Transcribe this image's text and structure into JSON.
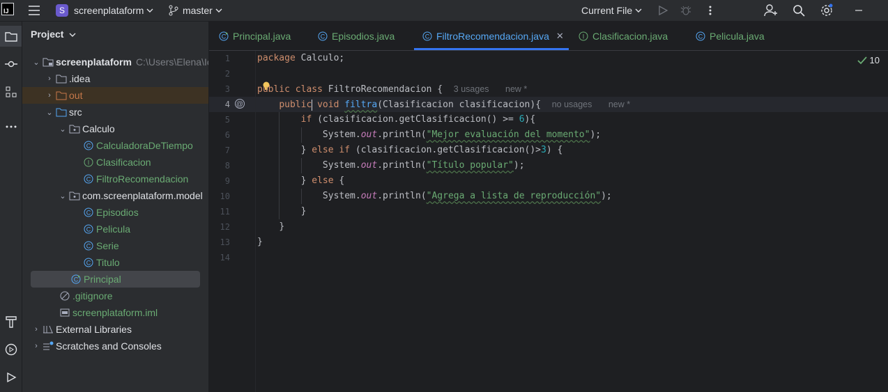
{
  "topbar": {
    "project_initial": "S",
    "project_name": "screenplataform",
    "branch": "master",
    "run_config": "Current File"
  },
  "project_panel": {
    "title": "Project",
    "root": "screenplataform",
    "root_path": "C:\\Users\\Elena\\Ic",
    "items": {
      "idea": ".idea",
      "out": "out",
      "src": "src",
      "calculo": "Calculo",
      "calculadora": "CalculadoraDeTiempo",
      "clasificacion": "Clasificacion",
      "filtro": "FiltroRecomendacion",
      "model": "com.screenplataform.model",
      "episodios": "Episodios",
      "pelicula": "Pelicula",
      "serie": "Serie",
      "titulo": "Titulo",
      "principal": "Principal",
      "gitignore": ".gitignore",
      "iml": "screenplataform.iml",
      "external": "External Libraries",
      "scratches": "Scratches and Consoles"
    }
  },
  "tabs": [
    {
      "label": "Principal.java"
    },
    {
      "label": "Episodios.java"
    },
    {
      "label": "FiltroRecomendacion.java"
    },
    {
      "label": "Clasificacion.java"
    },
    {
      "label": "Pelicula.java"
    }
  ],
  "editor": {
    "inspection_count": "10",
    "line_numbers": [
      "1",
      "2",
      "3",
      "4",
      "5",
      "6",
      "7",
      "8",
      "9",
      "10",
      "11",
      "12",
      "13",
      "14"
    ],
    "code": {
      "l1_kw": "package",
      "l1_rest": " Calculo;",
      "l3_kw1": "public",
      "l3_kw2": "class",
      "l3_name": "FiltroRecomendacion",
      "l3_brace": " {",
      "l3_hint_usages": "3 usages",
      "l3_hint_new": "new *",
      "l4_kw1": "public",
      "l4_kw2": "void",
      "l4_fn": "filtra",
      "l4_params": "(Clasificacion clasificacion){",
      "l4_hint_usages": "no usages",
      "l4_hint_new": "new *",
      "l5_kw": "if",
      "l5_a": " (clasificacion.getClasificacion() >= ",
      "l5_num": "6",
      "l5_b": "){",
      "l6_a": "System.",
      "l6_out": "out",
      "l6_b": ".println(",
      "l6_str": "\"Mejor evaluación del momento\"",
      "l6_c": ");",
      "l7_a": "} ",
      "l7_kw1": "else",
      "l7_kw2": "if",
      "l7_b": " (clasificacion.getClasificacion()>",
      "l7_num": "3",
      "l7_c": ") {",
      "l8_a": "System.",
      "l8_out": "out",
      "l8_b": ".println(",
      "l8_str": "\"Título popular\"",
      "l8_c": ");",
      "l9_a": "} ",
      "l9_kw": "else",
      "l9_b": " {",
      "l10_a": "System.",
      "l10_out": "out",
      "l10_b": ".println(",
      "l10_str": "\"Agrega a lista de reproducción\"",
      "l10_c": ");",
      "l11": "}",
      "l12": "}",
      "l13": "}"
    }
  },
  "colors": {
    "keyword": "#cf8e6d",
    "function": "#56a8f5",
    "string": "#6aab73",
    "number": "#2aacb8",
    "field": "#c77dbb",
    "accent": "#3574f0"
  },
  "icons": [
    "menu-icon",
    "branch-icon",
    "run-icon",
    "debug-icon",
    "more-icon",
    "add-user-icon",
    "search-icon",
    "settings-icon",
    "minimize-icon",
    "folder-icon",
    "commit-icon",
    "structure-icon",
    "build-icon",
    "services-icon",
    "run-tool-icon"
  ]
}
